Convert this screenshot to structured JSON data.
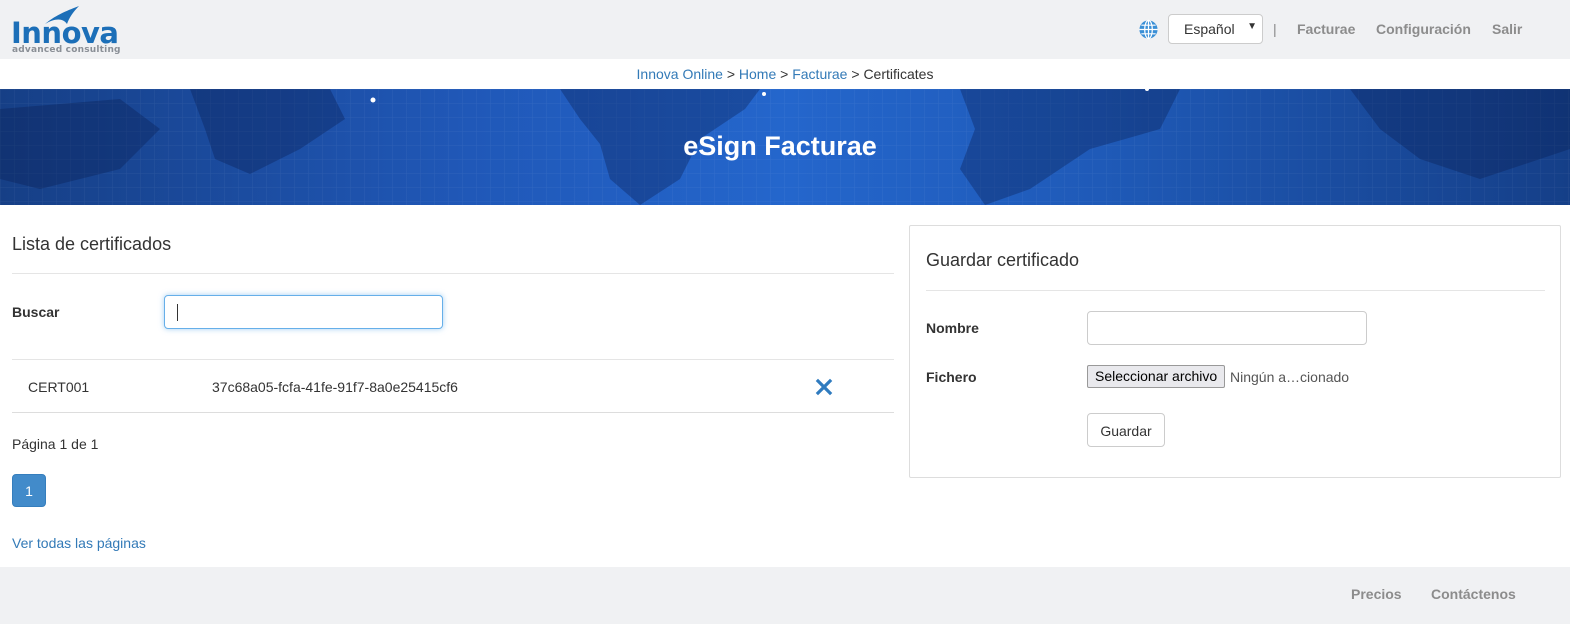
{
  "header": {
    "logo": {
      "name": "Innova",
      "tagline": "advanced consulting"
    },
    "language": {
      "icon": "globe-icon",
      "selected": "Español"
    },
    "separator": "|",
    "nav": [
      "Facturae",
      "Configuración",
      "Salir"
    ]
  },
  "breadcrumb": {
    "items": [
      "Innova Online",
      "Home",
      "Facturae"
    ],
    "current": "Certificates",
    "separator": ">"
  },
  "banner": {
    "title": "eSign Facturae"
  },
  "list": {
    "title": "Lista de certificados",
    "search_label": "Buscar",
    "search_value": "",
    "rows": [
      {
        "name": "CERT001",
        "id": "37c68a05-fcfa-41fe-91f7-8a0e25415cf6",
        "action_icon": "delete-x-icon"
      }
    ],
    "pagination_text": "Página 1 de 1",
    "current_page": "1",
    "all_pages_link": "Ver todas las páginas"
  },
  "form": {
    "title": "Guardar certificado",
    "name_label": "Nombre",
    "name_value": "",
    "file_label": "Fichero",
    "file_button": "Seleccionar archivo",
    "file_status": "Ningún a…cionado",
    "save_button": "Guardar"
  },
  "footer": {
    "links": [
      "Precios",
      "Contáctenos"
    ]
  },
  "colors": {
    "link": "#337ab7",
    "primary": "#428bca",
    "delete": "#2f7bbf",
    "banner": "#2058b8",
    "bar_bg": "#f0f1f3"
  }
}
